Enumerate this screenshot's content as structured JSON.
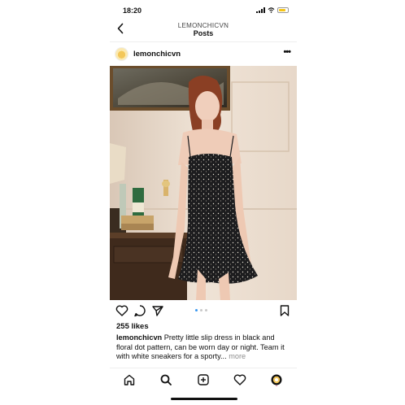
{
  "status_bar": {
    "time": "18:20"
  },
  "header": {
    "account": "LEMONCHICVN",
    "title": "Posts"
  },
  "post": {
    "username": "lemonchicvn",
    "likes": "255 likes",
    "caption_user": "lemonchicvn",
    "caption_text": " Pretty little slip dress in black and floral dot pattern, can be worn day or night. Team it with white sneakers for a sporty...",
    "caption_more": " more",
    "carousel": {
      "count": 3,
      "active": 1
    }
  },
  "icons": {
    "back": "chevron-left-icon",
    "options": "more-horizontal-icon",
    "like": "heart-icon",
    "comment": "comment-icon",
    "share": "send-icon",
    "save": "bookmark-icon",
    "tabs": [
      "home-icon",
      "search-icon",
      "new-post-icon",
      "activity-heart-icon",
      "profile-icon"
    ]
  },
  "colors": {
    "link_blue": "#3897f0",
    "muted": "#8e8e8e",
    "battery": "#f5c518"
  }
}
